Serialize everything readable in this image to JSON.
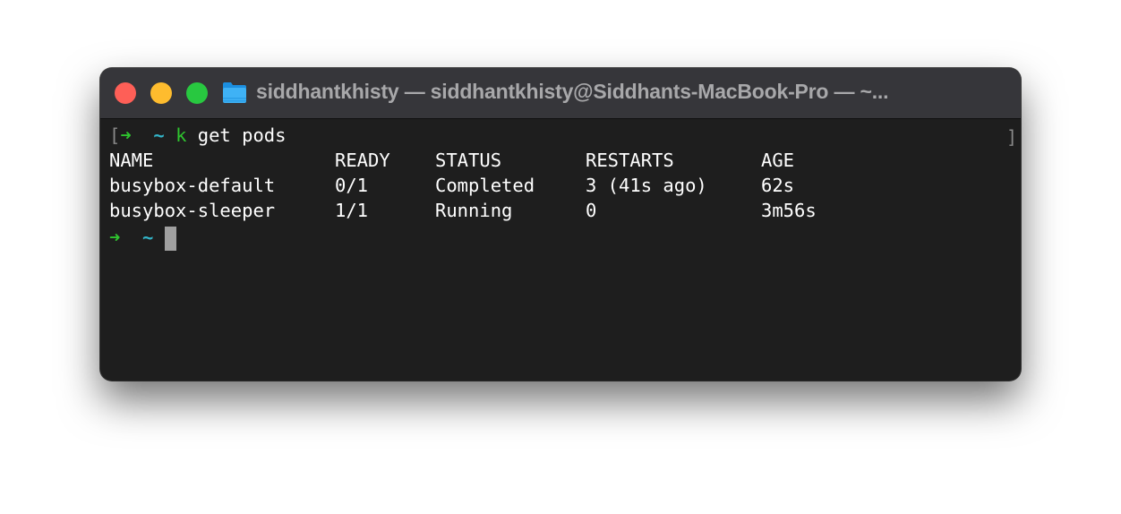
{
  "window": {
    "title": "siddhantkhisty — siddhantkhisty@Siddhants-MacBook-Pro — ~...",
    "icon": "folder-icon",
    "traffic_lights": {
      "close": "#fe5f57",
      "minimize": "#febc2e",
      "maximize": "#28c840"
    }
  },
  "terminal": {
    "prompt1": {
      "bracket": "[",
      "arrow": "➜",
      "dir": "~",
      "cmd_name": "k",
      "cmd_args": "get pods"
    },
    "right_bracket": "]",
    "table": {
      "headers": [
        "NAME",
        "READY",
        "STATUS",
        "RESTARTS",
        "AGE"
      ],
      "rows": [
        [
          "busybox-default",
          "0/1",
          "Completed",
          "3 (41s ago)",
          "62s"
        ],
        [
          "busybox-sleeper",
          "1/1",
          "Running",
          "0",
          "3m56s"
        ]
      ]
    },
    "prompt2": {
      "arrow": "➜",
      "dir": "~"
    },
    "colors": {
      "background": "#1e1e1e",
      "text": "#ffffff",
      "arrow": "#2fc52f",
      "tilde": "#33b5c9",
      "cursor": "#a0a0a0"
    }
  }
}
